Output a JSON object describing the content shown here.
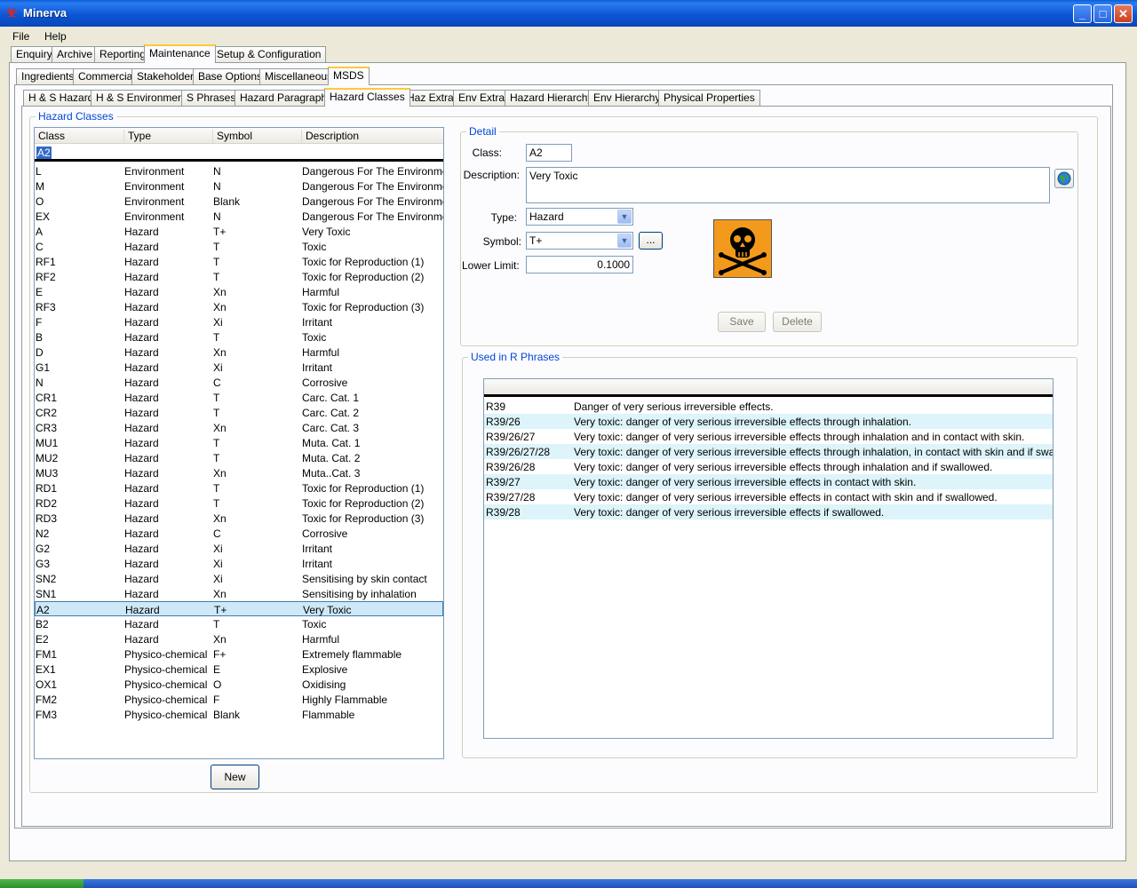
{
  "window": {
    "title": "Minerva"
  },
  "menu": [
    "File",
    "Help"
  ],
  "main_tabs": [
    "Enquiry",
    "Archive",
    "Reporting",
    "Maintenance",
    "Setup & Configuration"
  ],
  "sub_tabs": [
    "Ingredients",
    "Commercial",
    "Stakeholder",
    "Base Options",
    "Miscellaneous",
    "MSDS"
  ],
  "msds_tabs": [
    "H & S Hazard",
    "H & S Environment",
    "S Phrases",
    "Hazard Paragraphs",
    "Hazard Classes",
    "Haz Extra",
    "Env Extra",
    "Hazard Hierarchy",
    "Env Hierarchy",
    "Physical Properties"
  ],
  "hazard_classes": {
    "group_label": "Hazard Classes",
    "columns": [
      "Class",
      "Type",
      "Symbol",
      "Description"
    ],
    "filter_value": "A2",
    "rows": [
      [
        "L",
        "Environment",
        "N",
        "Dangerous For The Environment"
      ],
      [
        "M",
        "Environment",
        "N",
        "Dangerous For The Environment"
      ],
      [
        "O",
        "Environment",
        "Blank",
        "Dangerous For The Environment"
      ],
      [
        "EX",
        "Environment",
        "N",
        "Dangerous For The Environment"
      ],
      [
        "A",
        "Hazard",
        "T+",
        "Very Toxic"
      ],
      [
        "C",
        "Hazard",
        "T",
        "Toxic"
      ],
      [
        "RF1",
        "Hazard",
        "T",
        "Toxic for Reproduction (1)"
      ],
      [
        "RF2",
        "Hazard",
        "T",
        "Toxic for Reproduction (2)"
      ],
      [
        "E",
        "Hazard",
        "Xn",
        "Harmful"
      ],
      [
        "RF3",
        "Hazard",
        "Xn",
        "Toxic for Reproduction (3)"
      ],
      [
        "F",
        "Hazard",
        "Xi",
        "Irritant"
      ],
      [
        "B",
        "Hazard",
        "T",
        "Toxic"
      ],
      [
        "D",
        "Hazard",
        "Xn",
        "Harmful"
      ],
      [
        "G1",
        "Hazard",
        "Xi",
        "Irritant"
      ],
      [
        "N",
        "Hazard",
        "C",
        "Corrosive"
      ],
      [
        "CR1",
        "Hazard",
        "T",
        "Carc. Cat. 1"
      ],
      [
        "CR2",
        "Hazard",
        "T",
        "Carc. Cat. 2"
      ],
      [
        "CR3",
        "Hazard",
        "Xn",
        "Carc. Cat. 3"
      ],
      [
        "MU1",
        "Hazard",
        "T",
        "Muta. Cat. 1"
      ],
      [
        "MU2",
        "Hazard",
        "T",
        "Muta. Cat. 2"
      ],
      [
        "MU3",
        "Hazard",
        "Xn",
        "Muta..Cat. 3"
      ],
      [
        "RD1",
        "Hazard",
        "T",
        "Toxic for Reproduction (1)"
      ],
      [
        "RD2",
        "Hazard",
        "T",
        "Toxic for Reproduction (2)"
      ],
      [
        "RD3",
        "Hazard",
        "Xn",
        "Toxic for Reproduction (3)"
      ],
      [
        "N2",
        "Hazard",
        "C",
        "Corrosive"
      ],
      [
        "G2",
        "Hazard",
        "Xi",
        "Irritant"
      ],
      [
        "G3",
        "Hazard",
        "Xi",
        "Irritant"
      ],
      [
        "SN2",
        "Hazard",
        "Xi",
        "Sensitising by skin contact"
      ],
      [
        "SN1",
        "Hazard",
        "Xn",
        "Sensitising by inhalation"
      ],
      [
        "A2",
        "Hazard",
        "T+",
        "Very Toxic"
      ],
      [
        "B2",
        "Hazard",
        "T",
        "Toxic"
      ],
      [
        "E2",
        "Hazard",
        "Xn",
        "Harmful"
      ],
      [
        "FM1",
        "Physico-chemical",
        "F+",
        "Extremely flammable"
      ],
      [
        "EX1",
        "Physico-chemical",
        "E",
        "Explosive"
      ],
      [
        "OX1",
        "Physico-chemical",
        "O",
        "Oxidising"
      ],
      [
        "FM2",
        "Physico-chemical",
        "F",
        "Highly Flammable"
      ],
      [
        "FM3",
        "Physico-chemical",
        "Blank",
        "Flammable"
      ]
    ],
    "selected_index": 29,
    "new_label": "New"
  },
  "detail": {
    "group_label": "Detail",
    "class_label": "Class:",
    "class_value": "A2",
    "description_label": "Description:",
    "description_value": "Very Toxic",
    "type_label": "Type:",
    "type_value": "Hazard",
    "symbol_label": "Symbol:",
    "symbol_value": "T+",
    "lower_limit_label": "Lower Limit:",
    "lower_limit_value": "0.1000",
    "browse_label": "...",
    "save_label": "Save",
    "delete_label": "Delete"
  },
  "r_phrases": {
    "group_label": "Used in R Phrases",
    "rows": [
      [
        "R39",
        "Danger of very serious irreversible effects."
      ],
      [
        "R39/26",
        "Very toxic: danger of very serious irreversible effects through inhalation."
      ],
      [
        "R39/26/27",
        "Very toxic: danger of very serious irreversible effects through inhalation and in contact with skin."
      ],
      [
        "R39/26/27/28",
        "Very toxic: danger of very serious irreversible effects through inhalation, in contact with skin and if swallowed."
      ],
      [
        "R39/26/28",
        "Very toxic: danger of very serious irreversible effects through inhalation and if swallowed."
      ],
      [
        "R39/27",
        "Very toxic: danger of very serious irreversible effects in contact with skin."
      ],
      [
        "R39/27/28",
        "Very toxic: danger of very serious irreversible effects in contact with skin and if swallowed."
      ],
      [
        "R39/28",
        "Very toxic: danger of very serious irreversible effects if swallowed."
      ]
    ]
  },
  "colors": {
    "titlebar": "#0b56d6",
    "group_label": "#0046d5",
    "selected_row": "#cfe8f8",
    "alt_row": "#ddf4fa",
    "hazard_orange": "#f39a1c"
  }
}
